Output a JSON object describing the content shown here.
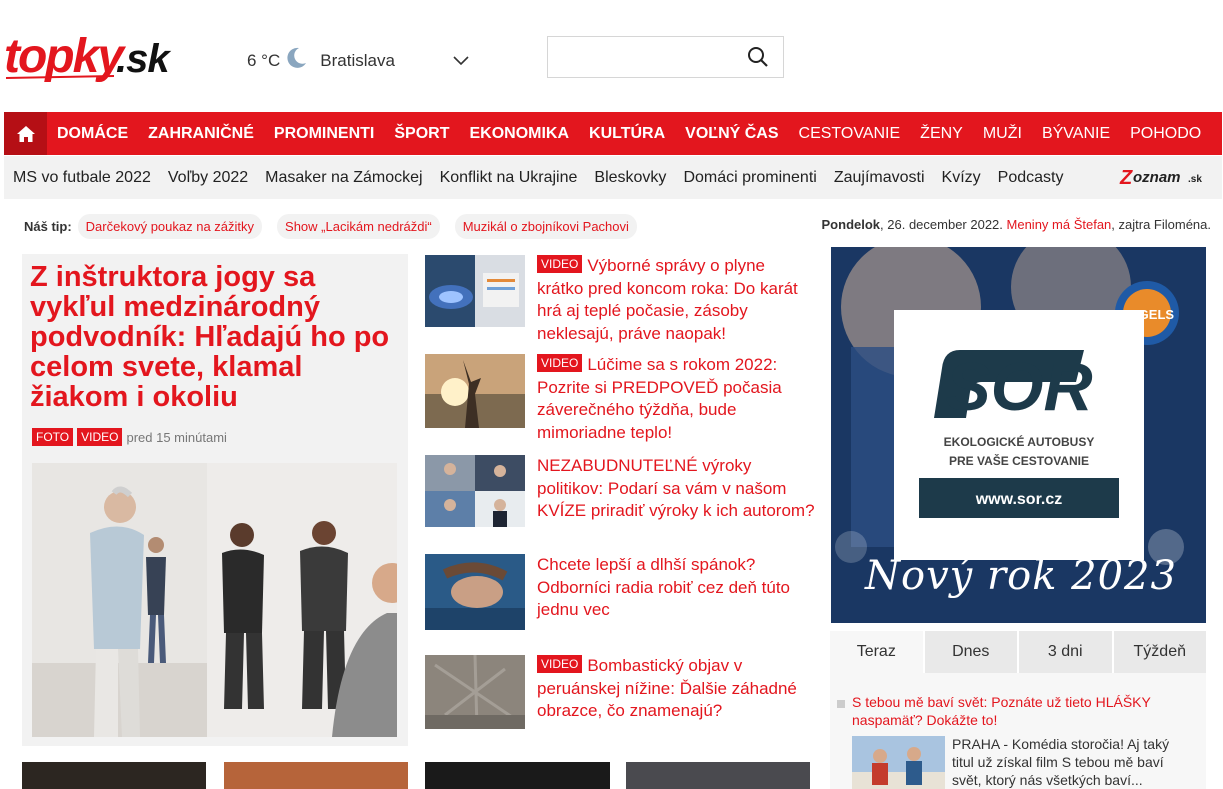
{
  "header": {
    "logo_text": "topky.sk",
    "weather": {
      "temperature": "6 °C",
      "city": "Bratislava"
    },
    "search": {
      "placeholder": ""
    }
  },
  "main_nav": {
    "items": [
      {
        "label": "DOMÁCE",
        "bold": true
      },
      {
        "label": "ZAHRANIČNÉ",
        "bold": true
      },
      {
        "label": "PROMINENTI",
        "bold": true
      },
      {
        "label": "ŠPORT",
        "bold": true
      },
      {
        "label": "EKONOMIKA",
        "bold": true
      },
      {
        "label": "KULTÚRA",
        "bold": true
      },
      {
        "label": "VOĽNÝ ČAS",
        "bold": true
      },
      {
        "label": "CESTOVANIE",
        "bold": false
      },
      {
        "label": "ŽENY",
        "bold": false
      },
      {
        "label": "MUŽI",
        "bold": false
      },
      {
        "label": "BÝVANIE",
        "bold": false
      },
      {
        "label": "POHODO",
        "bold": false
      }
    ]
  },
  "sub_nav": {
    "items": [
      "MS vo futbale 2022",
      "Voľby 2022",
      "Masaker na Zámockej",
      "Konflikt na Ukrajine",
      "Bleskovky",
      "Domáci prominenti",
      "Zaujímavosti",
      "Kvízy",
      "Podcasty"
    ],
    "partner_logo": "Zoznam.sk"
  },
  "tips": {
    "label": "Náš tip:",
    "chips": [
      "Darčekový poukaz na zážitky",
      "Show „Lacikám nedráždi“",
      "Muzikál o zbojníkovi Pachovi"
    ]
  },
  "dateline": {
    "day": "Pondelok",
    "date": ", 26. december 2022.",
    "nameday": "Meniny má Štefan",
    "tomorrow": ", zajtra Filoména."
  },
  "lead": {
    "headline": "Z inštruktora jogy sa vykľul medzinárodný podvodník: Hľadajú ho po celom svete, klamal žiakom i okoliu",
    "badges": [
      "FOTO",
      "VIDEO"
    ],
    "time": "pred 15 minútami"
  },
  "articles": [
    {
      "badge": "VIDEO",
      "title": "Výborné správy o plyne krátko pred koncom roka: Do karát hrá aj teplé počasie, zásoby neklesajú, práve naopak!"
    },
    {
      "badge": "VIDEO",
      "title": "Lúčime sa s rokom 2022: Pozrite si PREDPOVEĎ počasia záverečného týždňa, bude mimoriadne teplo!"
    },
    {
      "badge": "",
      "title": "NEZABUDNUTEĽNÉ výroky politikov: Podarí sa vám v našom KVÍZE priradiť výroky k ich autorom?"
    },
    {
      "badge": "",
      "title": "Chcete lepší a dlhší spánok? Odborníci radia robiť cez deň túto jednu vec"
    },
    {
      "badge": "VIDEO",
      "title": "Bombastický objav v peruánskej nížine: Ďalšie záhadné obrazce, čo znamenajú?"
    }
  ],
  "ad": {
    "brand": "SOR",
    "tagline_1": "EKOLOGICKÉ AUTOBUSY",
    "tagline_2": "PRE VAŠE CESTOVANIE",
    "url": "www.sor.cz",
    "year_text": "Nový rok 2023",
    "team_badge": "ANGELS"
  },
  "tabs": {
    "items": [
      "Teraz",
      "Dnes",
      "3 dni",
      "Týždeň"
    ],
    "active": 0
  },
  "side": {
    "headline": "S tebou mě baví svět: Poznáte už tieto HLÁŠKY naspamäť? Dokážte to!",
    "text": "PRAHA - Komédia storočia! Aj taký titul už získal film S tebou mě baví svět, ktorý nás všetkých baví..."
  },
  "colors": {
    "brand_red": "#e3161e",
    "nav_home": "#b50f15",
    "light_gray": "#f2f2f2"
  }
}
